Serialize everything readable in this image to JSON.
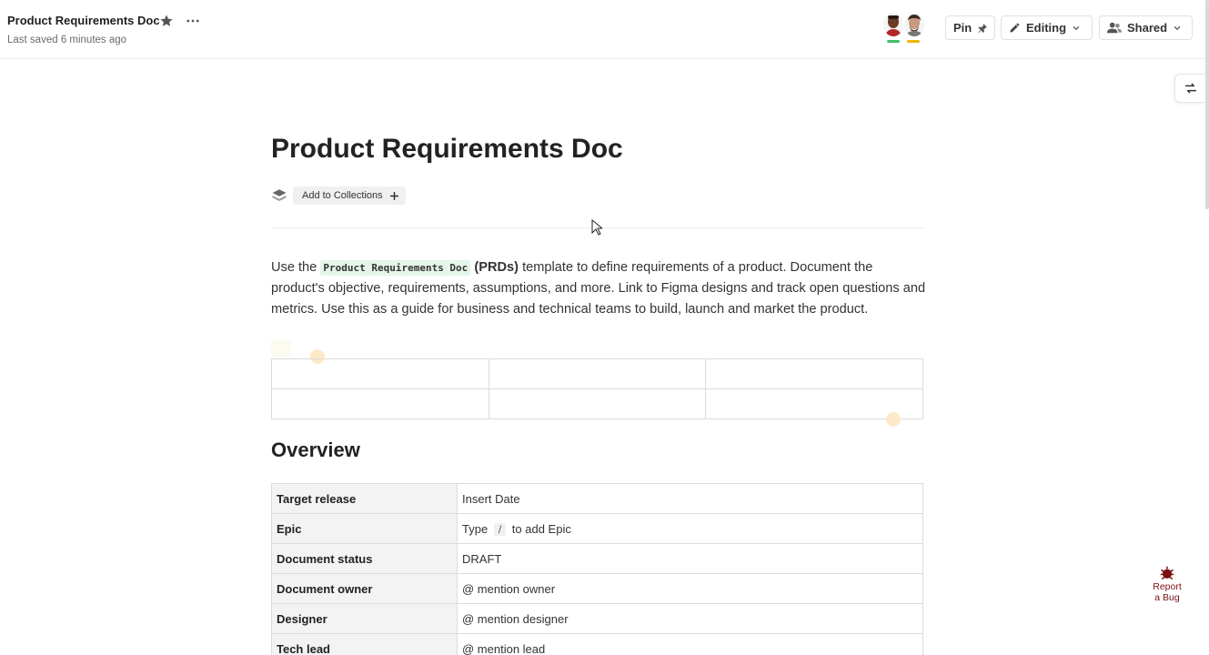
{
  "header": {
    "title": "Product Requirements Doc",
    "last_saved": "Last saved 6 minutes ago",
    "pin_label": "Pin",
    "editing_label": "Editing",
    "shared_label": "Shared",
    "avatars": [
      {
        "name": "collaborator-1",
        "bar_color": "#3fbf6a"
      },
      {
        "name": "collaborator-2",
        "bar_color": "#f0b400"
      }
    ]
  },
  "document": {
    "title": "Product Requirements Doc",
    "add_to_collections": "Add to Collections",
    "intro": {
      "before": "Use the ",
      "code": "Product Requirements Doc",
      "bold": "(PRDs)",
      "after": " template to define requirements of a product. Document the product's objective, requirements, assumptions, and more. Link to Figma designs and track open questions and metrics. Use this as a guide for business and technical teams to build, launch and market the product."
    },
    "overview_heading": "Overview",
    "overview_rows": [
      {
        "key": "Target release",
        "value": "Insert Date"
      },
      {
        "key": "Epic",
        "value_before": "Type",
        "value_code": "/",
        "value_after": "to add Epic"
      },
      {
        "key": "Document status",
        "value": "DRAFT"
      },
      {
        "key": "Document owner",
        "value": "@ mention owner"
      },
      {
        "key": "Designer",
        "value": "@ mention designer"
      },
      {
        "key": "Tech lead",
        "value": "@ mention lead"
      }
    ]
  },
  "report_bug": {
    "line1": "Report",
    "line2": "a Bug"
  },
  "colors": {
    "accent_code_bg": "#e6f5e9",
    "bug_red": "#7a1010"
  }
}
